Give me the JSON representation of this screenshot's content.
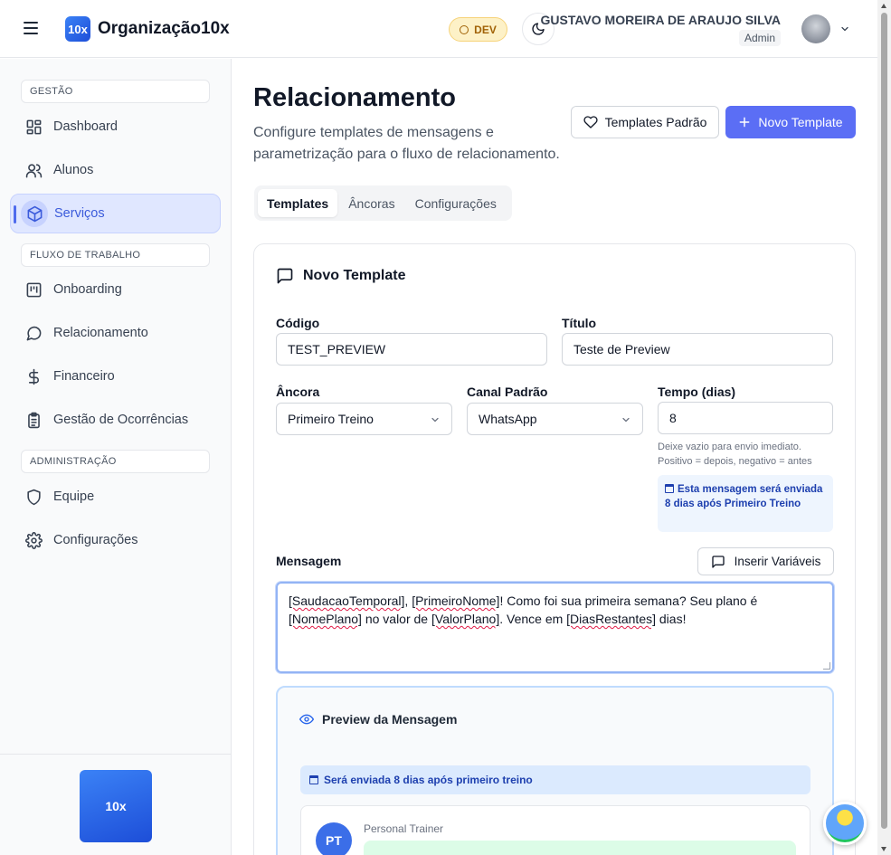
{
  "header": {
    "logo_text": "10x",
    "org_name": "Organização10x",
    "env_badge": "DEV",
    "user_name": "GUSTAVO MOREIRA DE ARAUJO SILVA",
    "user_role": "Admin"
  },
  "sidebar": {
    "sections": [
      {
        "label": "GESTÃO"
      },
      {
        "label": "FLUXO DE TRABALHO"
      },
      {
        "label": "ADMINISTRAÇÃO"
      }
    ],
    "items": [
      {
        "label": "Dashboard",
        "icon": "dashboard-icon"
      },
      {
        "label": "Alunos",
        "icon": "users-icon"
      },
      {
        "label": "Serviços",
        "icon": "box-icon",
        "active": true
      },
      {
        "label": "Onboarding",
        "icon": "kanban-icon"
      },
      {
        "label": "Relacionamento",
        "icon": "chat-bubble-icon"
      },
      {
        "label": "Financeiro",
        "icon": "dollar-icon"
      },
      {
        "label": "Gestão de Ocorrências",
        "icon": "clipboard-icon"
      },
      {
        "label": "Equipe",
        "icon": "shield-icon"
      },
      {
        "label": "Configurações",
        "icon": "gear-icon"
      }
    ],
    "footer_logo": "10x"
  },
  "page": {
    "title": "Relacionamento",
    "description": "Configure templates de mensagens e parametrização para o fluxo de relacionamento.",
    "btn_templates_padrao": "Templates Padrão",
    "btn_novo_template": "Novo Template",
    "tabs": [
      "Templates",
      "Âncoras",
      "Configurações"
    ],
    "active_tab": "Templates"
  },
  "form": {
    "title": "Novo Template",
    "codigo_label": "Código",
    "codigo_value": "TEST_PREVIEW",
    "titulo_label": "Título",
    "titulo_value": "Teste de Preview",
    "ancora_label": "Âncora",
    "ancora_value": "Primeiro Treino",
    "canal_label": "Canal Padrão",
    "canal_value": "WhatsApp",
    "tempo_label": "Tempo (dias)",
    "tempo_value": "8",
    "tempo_hint_1": "Deixe vazio para envio imediato.",
    "tempo_hint_2": "Positivo = depois, negativo = antes",
    "tempo_info": "Esta mensagem será enviada 8 dias após Primeiro Treino",
    "mensagem_label": "Mensagem",
    "btn_inserir_variaveis": "Inserir Variáveis",
    "mensagem_parts": {
      "v1": "[SaudacaoTemporal]",
      "t1": ", ",
      "v2": "[PrimeiroNome]",
      "t2": "! Como foi sua primeira semana? Seu plano é ",
      "v3": "[NomePlano]",
      "t3": " no valor de ",
      "v4": "[ValorPlano]",
      "t4": ". Vence em ",
      "v5": "[DiasRestantes]",
      "t5": " dias!"
    }
  },
  "preview": {
    "title": "Preview da Mensagem",
    "banner": "Será enviada 8 dias após primeiro treino",
    "avatar_initials": "PT",
    "sender": "Personal Trainer"
  },
  "colors": {
    "primary": "#5b6ef5",
    "active_nav_bg": "#e0e7ff",
    "env_badge_bg": "#fdf1c7",
    "info_bg": "#eef5fe",
    "bubble_bg": "#dcfce7"
  }
}
